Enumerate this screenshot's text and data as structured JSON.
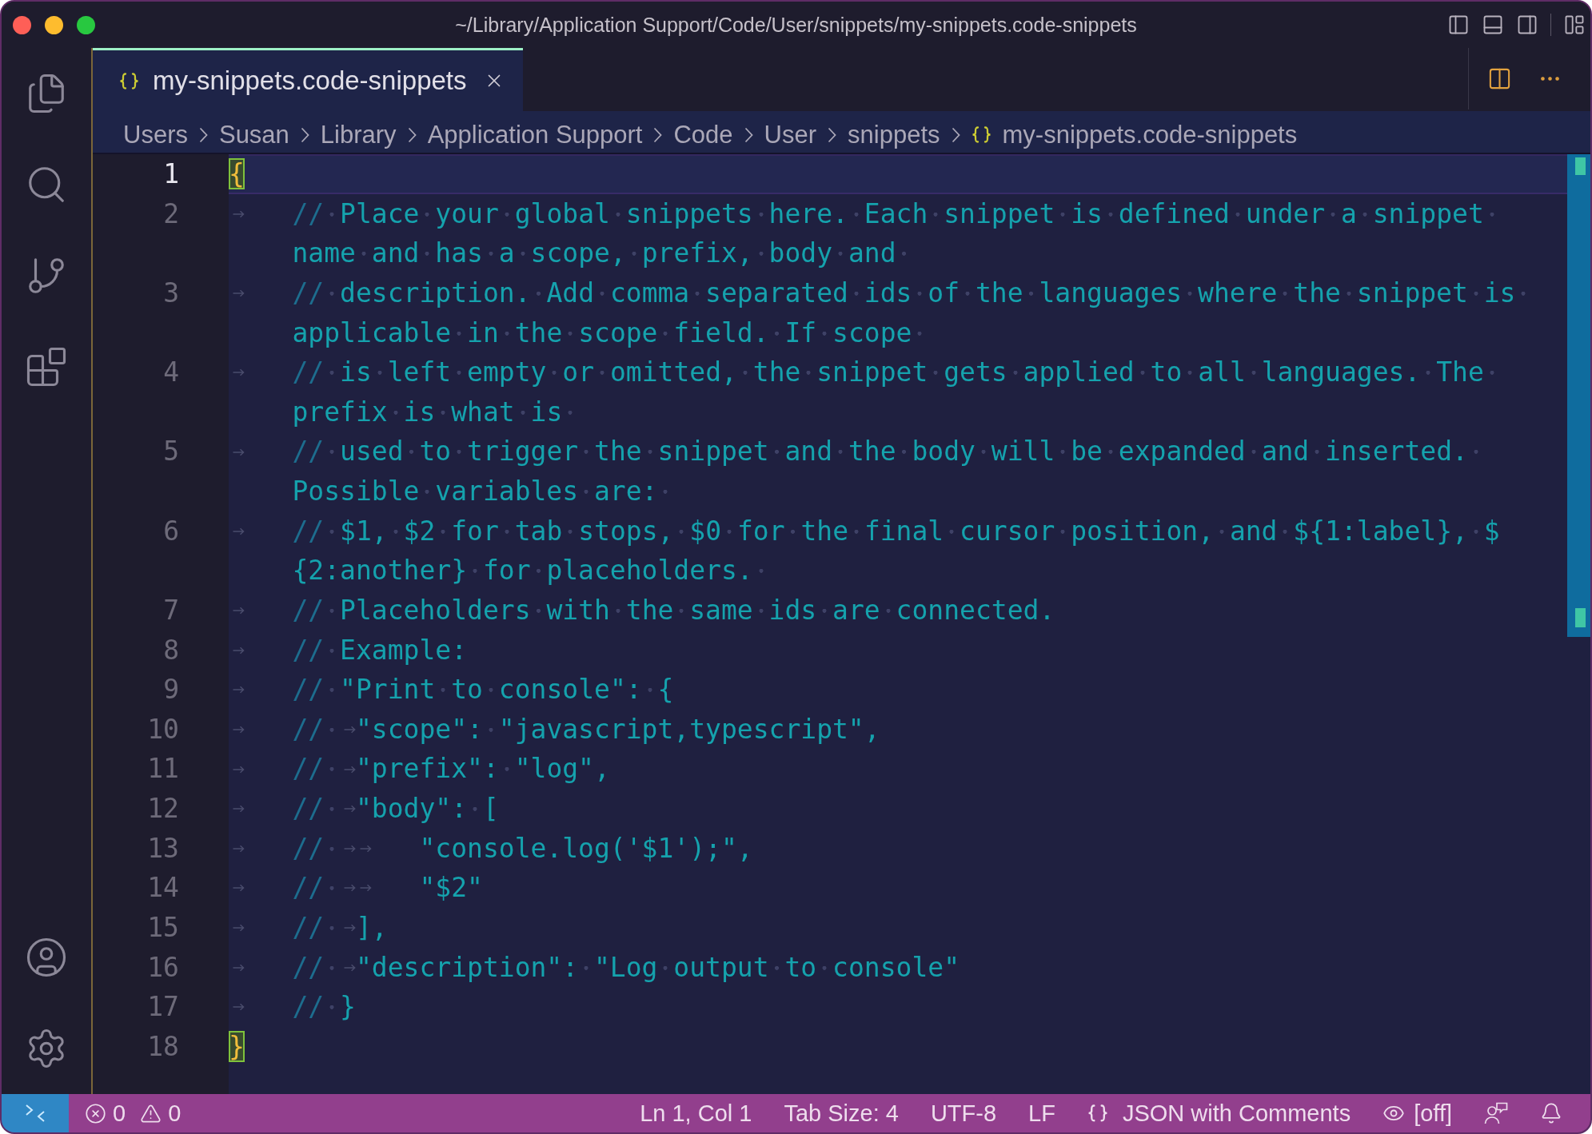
{
  "window": {
    "title": "~/Library/Application Support/Code/User/snippets/my-snippets.code-snippets"
  },
  "title_bar_actions": [
    {
      "kind": "sidebar-left"
    },
    {
      "kind": "panel"
    },
    {
      "kind": "sidebar-right"
    },
    {
      "kind": "layout"
    }
  ],
  "activity_bar": {
    "top": [
      {
        "kind": "explorer"
      },
      {
        "kind": "search"
      },
      {
        "kind": "source-control"
      },
      {
        "kind": "extensions"
      }
    ],
    "bottom": [
      {
        "kind": "accounts"
      },
      {
        "kind": "manage"
      }
    ]
  },
  "tabs": [
    {
      "label": "my-snippets.code-snippets",
      "selected": true
    }
  ],
  "editor_actions": [
    {
      "kind": "split"
    },
    {
      "kind": "more"
    }
  ],
  "breadcrumbs": {
    "folders": [
      "Users",
      "Susan",
      "Library",
      "Application Support",
      "Code",
      "User",
      "snippets"
    ],
    "file": "my-snippets.code-snippets"
  },
  "editor": {
    "lines": [
      {
        "number": "1",
        "current": true,
        "rows": [
          [
            {
              "kind": "bracket",
              "text": "{",
              "matched": true
            }
          ]
        ]
      },
      {
        "number": "2",
        "current": false,
        "rows": [
          [
            {
              "kind": "delimiter",
              "text": "\t//"
            },
            {
              "kind": "comment",
              "text": " Place your global snippets here. Each snippet is defined under a snippet "
            }
          ],
          [
            {
              "kind": "comment",
              "text": "name and has a scope, prefix, body and "
            }
          ]
        ]
      },
      {
        "number": "3",
        "current": false,
        "rows": [
          [
            {
              "kind": "delimiter",
              "text": "\t//"
            },
            {
              "kind": "comment",
              "text": " description. Add comma separated ids of the languages where the snippet is "
            }
          ],
          [
            {
              "kind": "comment",
              "text": "applicable in the scope field. If scope "
            }
          ]
        ]
      },
      {
        "number": "4",
        "current": false,
        "rows": [
          [
            {
              "kind": "delimiter",
              "text": "\t//"
            },
            {
              "kind": "comment",
              "text": " is left empty or omitted, the snippet gets applied to all languages. The "
            }
          ],
          [
            {
              "kind": "comment",
              "text": "prefix is what is "
            }
          ]
        ]
      },
      {
        "number": "5",
        "current": false,
        "rows": [
          [
            {
              "kind": "delimiter",
              "text": "\t//"
            },
            {
              "kind": "comment",
              "text": " used to trigger the snippet and the body will be expanded and inserted. "
            }
          ],
          [
            {
              "kind": "comment",
              "text": "Possible variables are: "
            }
          ]
        ]
      },
      {
        "number": "6",
        "current": false,
        "rows": [
          [
            {
              "kind": "delimiter",
              "text": "\t//"
            },
            {
              "kind": "comment",
              "text": " $1, $2 for tab stops, $0 for the final cursor position, and ${1:label}, $"
            }
          ],
          [
            {
              "kind": "comment",
              "text": "{2:another} for placeholders. "
            }
          ]
        ]
      },
      {
        "number": "7",
        "current": false,
        "rows": [
          [
            {
              "kind": "delimiter",
              "text": "\t//"
            },
            {
              "kind": "comment",
              "text": " Placeholders with the same ids are connected."
            }
          ]
        ]
      },
      {
        "number": "8",
        "current": false,
        "rows": [
          [
            {
              "kind": "delimiter",
              "text": "\t//"
            },
            {
              "kind": "comment",
              "text": " Example:"
            }
          ]
        ]
      },
      {
        "number": "9",
        "current": false,
        "rows": [
          [
            {
              "kind": "delimiter",
              "text": "\t//"
            },
            {
              "kind": "comment",
              "text": " \"Print to console\": {"
            }
          ]
        ]
      },
      {
        "number": "10",
        "current": false,
        "rows": [
          [
            {
              "kind": "delimiter",
              "text": "\t//"
            },
            {
              "kind": "comment",
              "text": " \t\"scope\": \"javascript,typescript\","
            }
          ]
        ]
      },
      {
        "number": "11",
        "current": false,
        "rows": [
          [
            {
              "kind": "delimiter",
              "text": "\t//"
            },
            {
              "kind": "comment",
              "text": " \t\"prefix\": \"log\","
            }
          ]
        ]
      },
      {
        "number": "12",
        "current": false,
        "rows": [
          [
            {
              "kind": "delimiter",
              "text": "\t//"
            },
            {
              "kind": "comment",
              "text": " \t\"body\": ["
            }
          ]
        ]
      },
      {
        "number": "13",
        "current": false,
        "rows": [
          [
            {
              "kind": "delimiter",
              "text": "\t//"
            },
            {
              "kind": "comment",
              "text": " \t\t\"console.log('$1');\","
            }
          ]
        ]
      },
      {
        "number": "14",
        "current": false,
        "rows": [
          [
            {
              "kind": "delimiter",
              "text": "\t//"
            },
            {
              "kind": "comment",
              "text": " \t\t\"$2\""
            }
          ]
        ]
      },
      {
        "number": "15",
        "current": false,
        "rows": [
          [
            {
              "kind": "delimiter",
              "text": "\t//"
            },
            {
              "kind": "comment",
              "text": " \t],"
            }
          ]
        ]
      },
      {
        "number": "16",
        "current": false,
        "rows": [
          [
            {
              "kind": "delimiter",
              "text": "\t//"
            },
            {
              "kind": "comment",
              "text": " \t\"description\": \"Log output to console\""
            }
          ]
        ]
      },
      {
        "number": "17",
        "current": false,
        "rows": [
          [
            {
              "kind": "delimiter",
              "text": "\t//"
            },
            {
              "kind": "comment",
              "text": " }"
            }
          ]
        ]
      },
      {
        "number": "18",
        "current": false,
        "rows": [
          [
            {
              "kind": "bracket",
              "text": "}",
              "matched": true
            }
          ]
        ]
      }
    ]
  },
  "status_bar": {
    "problems": {
      "errors": "0",
      "warnings": "0"
    },
    "items": [
      {
        "kind": "text",
        "label": "Ln 1, Col 1"
      },
      {
        "kind": "text",
        "label": "Tab Size: 4"
      },
      {
        "kind": "text",
        "label": "UTF-8"
      },
      {
        "kind": "text",
        "label": "LF"
      },
      {
        "kind": "language",
        "label": "JSON with Comments"
      },
      {
        "kind": "watch",
        "label": "[off]"
      },
      {
        "kind": "feedback"
      },
      {
        "kind": "notifications"
      }
    ]
  }
}
